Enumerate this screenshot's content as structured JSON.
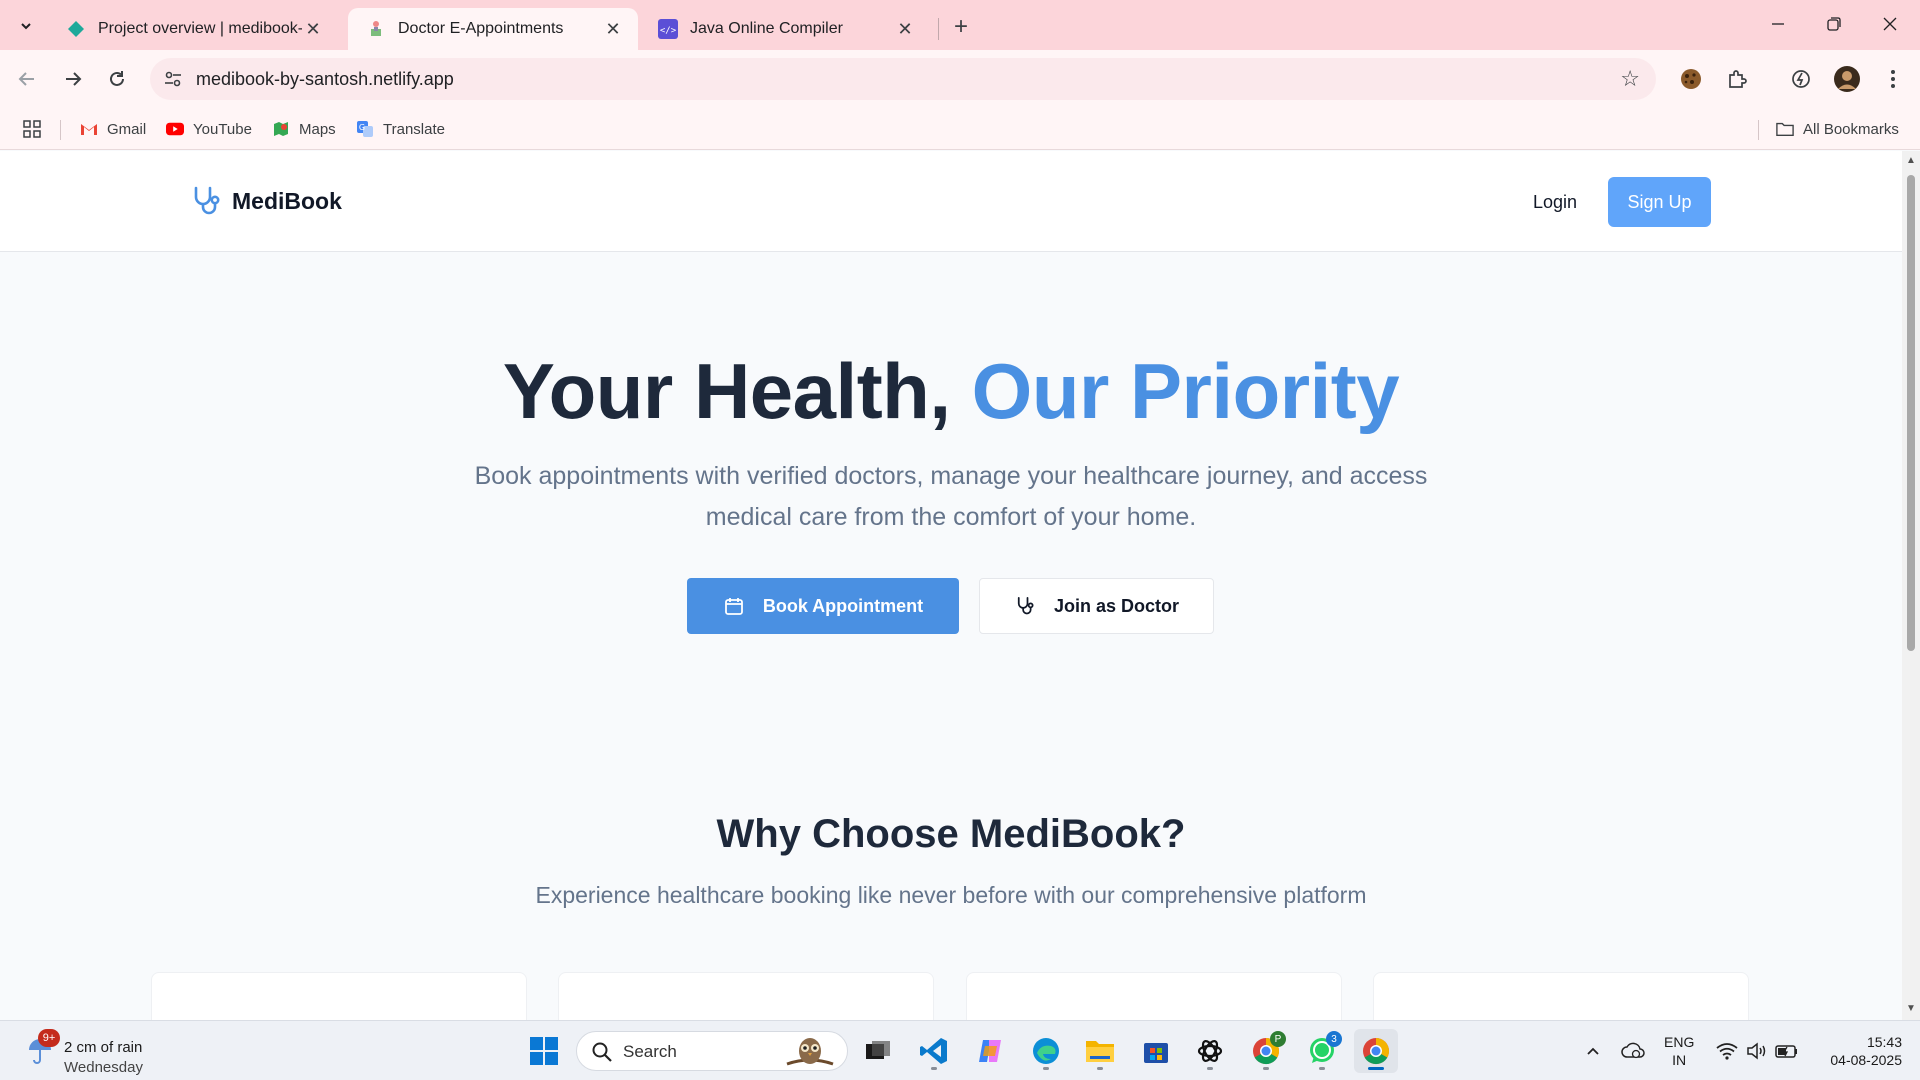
{
  "browser": {
    "tabs": [
      {
        "title": "Project overview | medibook-by",
        "active": false
      },
      {
        "title": "Doctor E-Appointments",
        "active": true
      },
      {
        "title": "Java Online Compiler",
        "active": false
      }
    ],
    "url": "medibook-by-santosh.netlify.app",
    "bookmarks": [
      {
        "label": "Gmail",
        "icon": "gmail-icon"
      },
      {
        "label": "YouTube",
        "icon": "youtube-icon"
      },
      {
        "label": "Maps",
        "icon": "maps-icon"
      },
      {
        "label": "Translate",
        "icon": "translate-icon"
      }
    ],
    "all_bookmarks": "All Bookmarks"
  },
  "site": {
    "brand": "MediBook",
    "nav": {
      "login": "Login",
      "signup": "Sign Up"
    },
    "hero": {
      "title_part1": "Your Health, ",
      "title_accent": "Our Priority",
      "subtitle": "Book appointments with verified doctors, manage your healthcare journey, and access medical care from the comfort of your home.",
      "cta_primary": "Book Appointment",
      "cta_secondary": "Join as Doctor"
    },
    "why": {
      "title": "Why Choose MediBook?",
      "subtitle": "Experience healthcare booking like never before with our comprehensive platform"
    },
    "accent_color": "#4a90e2"
  },
  "taskbar": {
    "weather_badge": "9+",
    "weather_line1": "2 cm of rain",
    "weather_line2": "Wednesday",
    "search_placeholder": "Search",
    "lang_line1": "ENG",
    "lang_line2": "IN",
    "time": "15:43",
    "date": "04-08-2025",
    "whatsapp_badge": "3",
    "chrome_profile_badge": "P"
  }
}
